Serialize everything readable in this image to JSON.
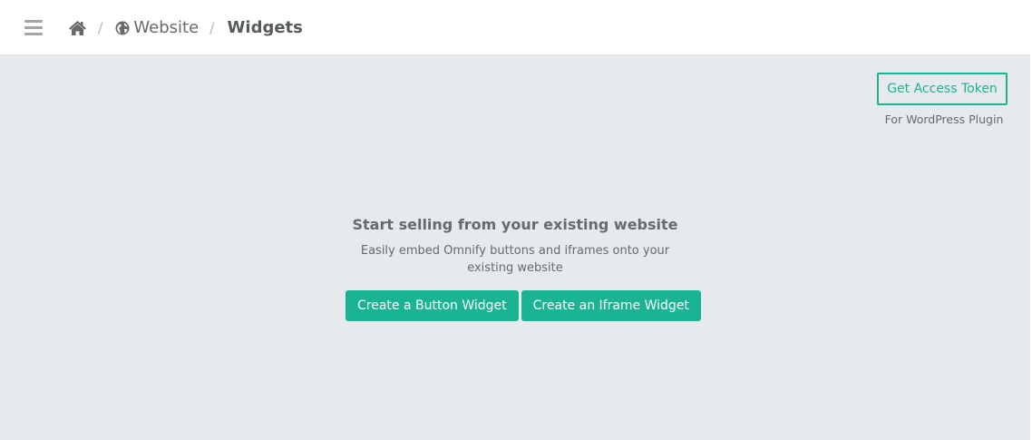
{
  "breadcrumb": {
    "website": "Website",
    "current": "Widgets"
  },
  "access_token": {
    "button_label": "Get Access Token",
    "caption": "For WordPress Plugin"
  },
  "empty_state": {
    "title": "Start selling from your existing website",
    "description": "Easily embed Omnify buttons and iframes onto your existing website",
    "button_widget_label": "Create a Button Widget",
    "iframe_widget_label": "Create an Iframe Widget"
  },
  "colors": {
    "accent": "#1ab394",
    "background": "#e7eaec",
    "text": "#676a6c"
  },
  "icons": {
    "menu": "hamburger-icon",
    "home": "home-icon",
    "website": "globe-icon"
  }
}
